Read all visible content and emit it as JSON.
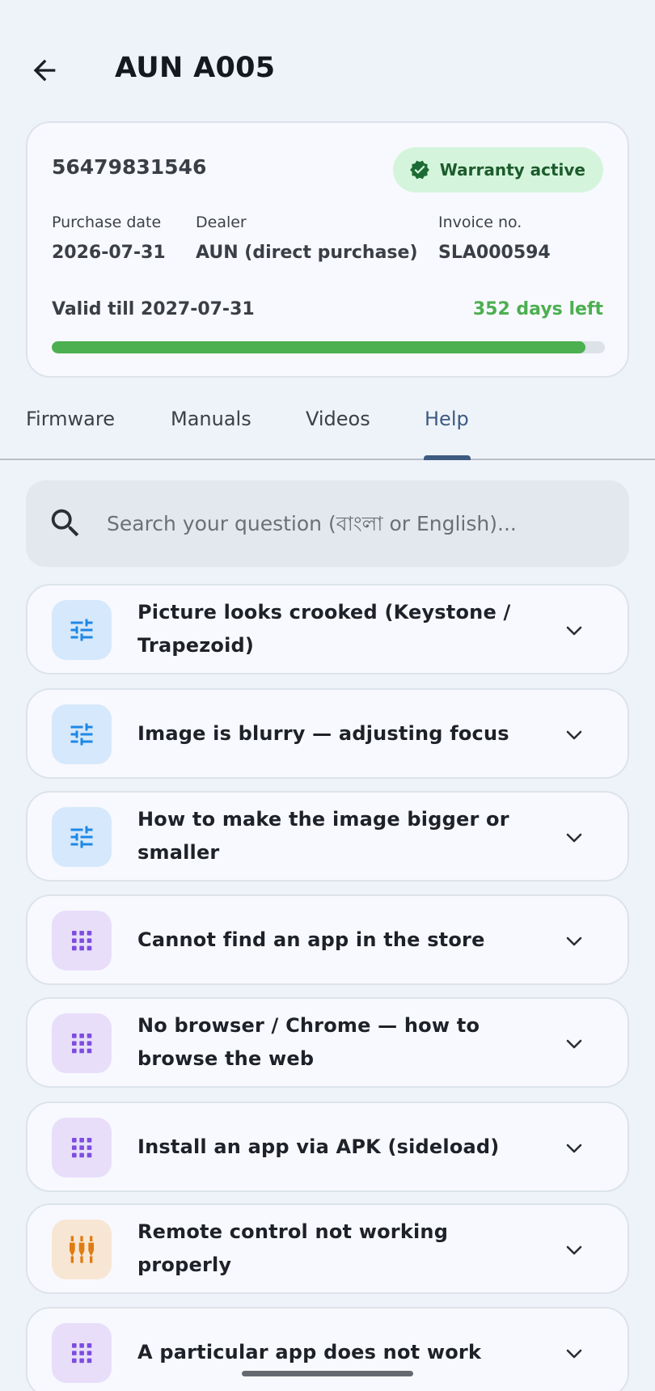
{
  "header": {
    "title": "AUN A005"
  },
  "warranty": {
    "serial": "56479831546",
    "badge": "Warranty active",
    "purchase_date_label": "Purchase date",
    "purchase_date": "2026-07-31",
    "dealer_label": "Dealer",
    "dealer": "AUN (direct purchase)",
    "invoice_label": "Invoice no.",
    "invoice": "SLA000594",
    "valid_till": "Valid till 2027-07-31",
    "days_left": "352 days left",
    "progress_fraction": 0.965
  },
  "tabs": [
    {
      "label": "Firmware"
    },
    {
      "label": "Manuals"
    },
    {
      "label": "Videos"
    },
    {
      "label": "Help"
    }
  ],
  "active_tab": "Help",
  "search": {
    "placeholder": "Search your question (বাংলা or English)..."
  },
  "faq": [
    {
      "title": "Picture looks crooked (Keystone / Trapezoid)",
      "icon": "sliders-icon",
      "color": "blue"
    },
    {
      "title": "Image is blurry — adjusting focus",
      "icon": "sliders-icon",
      "color": "blue"
    },
    {
      "title": "How to make the image bigger or smaller",
      "icon": "sliders-icon",
      "color": "blue"
    },
    {
      "title": "Cannot find an app in the store",
      "icon": "apps-grid-icon",
      "color": "purple"
    },
    {
      "title": "No browser / Chrome — how to browse the web",
      "icon": "apps-grid-icon",
      "color": "purple"
    },
    {
      "title": "Install an app via APK (sideload)",
      "icon": "apps-grid-icon",
      "color": "purple"
    },
    {
      "title": "Remote control not working properly",
      "icon": "equalizer-icon",
      "color": "orange"
    },
    {
      "title": "A particular app does not work",
      "icon": "apps-grid-icon",
      "color": "purple"
    }
  ],
  "colors": {
    "accent": "#3e5a80",
    "success": "#4caf50",
    "badge_bg": "#d4f5dc",
    "icon_blue": "#1e88e5",
    "icon_purple": "#7c4dde",
    "icon_orange": "#e07b10"
  }
}
